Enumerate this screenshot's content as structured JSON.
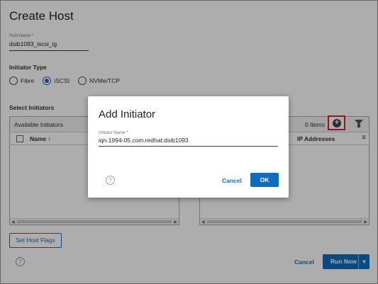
{
  "page": {
    "title": "Create Host",
    "host_name_label": "Host Name *",
    "host_name_value": "dsib1093_iscsi_ig",
    "initiator_type_label": "Initiator Type",
    "initiator_types": [
      "Fibre",
      "iSCSI",
      "NVMe/TCP"
    ],
    "initiator_type_selected": "iSCSI",
    "select_initiators_label": "Select Initiators",
    "available_panel": {
      "title": "Available Initiators",
      "columns": [
        "Name ↑"
      ]
    },
    "selected_panel": {
      "count_text": "0 Items",
      "columns": [
        "IP Addresses"
      ]
    },
    "set_host_flags": "Set Host Flags",
    "cancel": "Cancel",
    "run_now": "Run Now",
    "help": "?"
  },
  "modal": {
    "title": "Add Initiator",
    "field_label": "Initiator Name *",
    "field_value": "iqn.1994-05.com.redhat:dsib1093",
    "cancel": "Cancel",
    "ok": "OK",
    "help": "?"
  },
  "icons": {
    "add": "plus-circle-icon",
    "filter": "filter-icon",
    "menu": "hamburger-icon",
    "dropdown": "chevron-down-icon"
  },
  "colors": {
    "accent": "#0a6fc2",
    "highlight_border": "#e02020"
  }
}
